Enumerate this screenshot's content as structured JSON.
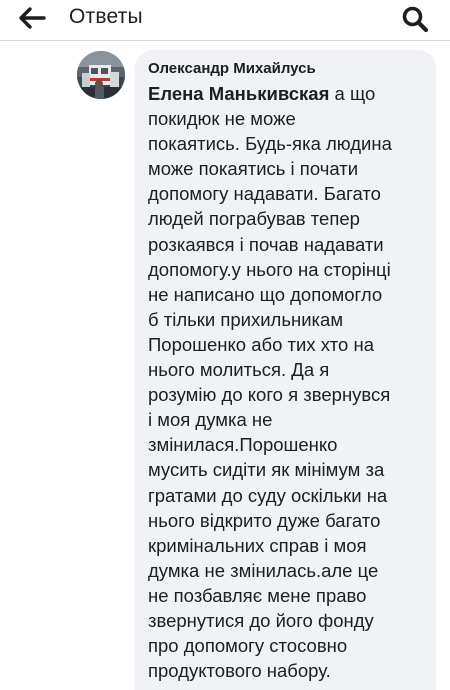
{
  "header": {
    "back_icon": "arrow-left-icon",
    "title": "Ответы",
    "search_icon": "search-icon"
  },
  "comment": {
    "avatar_icon": "profile-photo",
    "author": "Олександр Михайлусь",
    "mention": "Елена Манькивская",
    "lines": [
      " а що",
      "покидюк не може",
      "покаятись. Будь-яка людина",
      "може покаятись і почати",
      "допомогу надавати. Багато",
      "людей пограбував тепер",
      "розкаявся і почав надавати",
      "допомогу.у нього на сторінці",
      "не написано що допомогло",
      "б тільки прихильникам",
      "Порошенко або тих хто на",
      "нього молиться. Да я",
      "розумію до кого я звернувся",
      "і моя думка не",
      "змінилася.Порошенко",
      "мусить сидіти як мінімум за",
      "гратами до суду оскільки на",
      "нього відкрито дуже багато",
      "кримінальних справ і моя",
      "думка не змінилась.але це",
      "не позбавляє мене право",
      "звернутися до його фонду",
      "про допомогу стосовно",
      "продуктового набору."
    ]
  },
  "colors": {
    "bubble": "#f0f2f5",
    "text": "#1c1e21",
    "divider": "#d3d6db"
  }
}
